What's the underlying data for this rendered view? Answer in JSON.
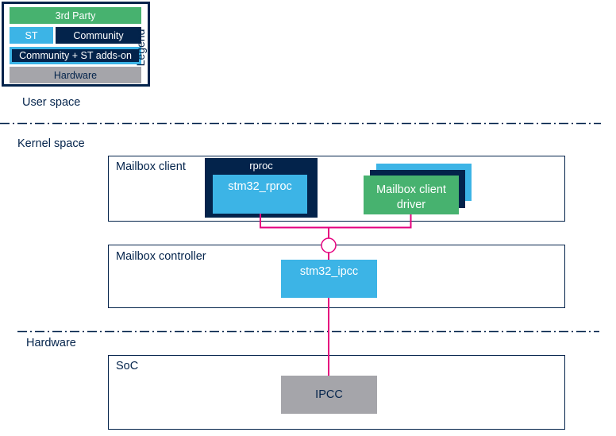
{
  "legend": {
    "title": "Legend",
    "items": [
      {
        "label": "3rd Party",
        "color": "#47b26f"
      },
      {
        "label": "ST",
        "color": "#3cb4e6"
      },
      {
        "label": "Community",
        "color": "#03234b"
      },
      {
        "label": "Community + ST adds-on",
        "color": "#03234b",
        "border_color": "#3cb4e6"
      },
      {
        "label": "Hardware",
        "color": "#a5a5aa"
      }
    ]
  },
  "layers": {
    "user_space": "User space",
    "kernel_space": "Kernel space",
    "hardware": "Hardware"
  },
  "mailbox_client": {
    "title": "Mailbox client",
    "rproc": {
      "label": "rproc",
      "child": "stm32_rproc"
    },
    "client_driver": {
      "line1": "Mailbox client",
      "line2": "driver"
    }
  },
  "mailbox_controller": {
    "title": "Mailbox controller",
    "driver": "stm32_ipcc"
  },
  "soc": {
    "title": "SoC",
    "block": "IPCC"
  },
  "colors": {
    "navy": "#03234b",
    "st_blue": "#3cb4e6",
    "third_party_green": "#47b26f",
    "hardware_grey": "#a5a5aa",
    "connector_pink": "#e6007e"
  }
}
